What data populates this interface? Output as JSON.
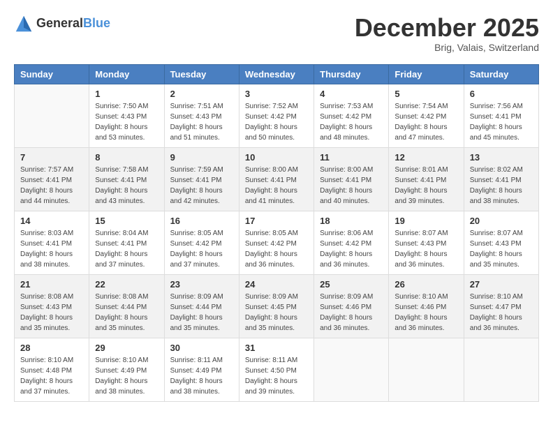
{
  "logo": {
    "text_general": "General",
    "text_blue": "Blue"
  },
  "title": "December 2025",
  "subtitle": "Brig, Valais, Switzerland",
  "days_of_week": [
    "Sunday",
    "Monday",
    "Tuesday",
    "Wednesday",
    "Thursday",
    "Friday",
    "Saturday"
  ],
  "weeks": [
    [
      {
        "day": "",
        "info": ""
      },
      {
        "day": "1",
        "info": "Sunrise: 7:50 AM\nSunset: 4:43 PM\nDaylight: 8 hours\nand 53 minutes."
      },
      {
        "day": "2",
        "info": "Sunrise: 7:51 AM\nSunset: 4:43 PM\nDaylight: 8 hours\nand 51 minutes."
      },
      {
        "day": "3",
        "info": "Sunrise: 7:52 AM\nSunset: 4:42 PM\nDaylight: 8 hours\nand 50 minutes."
      },
      {
        "day": "4",
        "info": "Sunrise: 7:53 AM\nSunset: 4:42 PM\nDaylight: 8 hours\nand 48 minutes."
      },
      {
        "day": "5",
        "info": "Sunrise: 7:54 AM\nSunset: 4:42 PM\nDaylight: 8 hours\nand 47 minutes."
      },
      {
        "day": "6",
        "info": "Sunrise: 7:56 AM\nSunset: 4:41 PM\nDaylight: 8 hours\nand 45 minutes."
      }
    ],
    [
      {
        "day": "7",
        "info": "Sunrise: 7:57 AM\nSunset: 4:41 PM\nDaylight: 8 hours\nand 44 minutes."
      },
      {
        "day": "8",
        "info": "Sunrise: 7:58 AM\nSunset: 4:41 PM\nDaylight: 8 hours\nand 43 minutes."
      },
      {
        "day": "9",
        "info": "Sunrise: 7:59 AM\nSunset: 4:41 PM\nDaylight: 8 hours\nand 42 minutes."
      },
      {
        "day": "10",
        "info": "Sunrise: 8:00 AM\nSunset: 4:41 PM\nDaylight: 8 hours\nand 41 minutes."
      },
      {
        "day": "11",
        "info": "Sunrise: 8:00 AM\nSunset: 4:41 PM\nDaylight: 8 hours\nand 40 minutes."
      },
      {
        "day": "12",
        "info": "Sunrise: 8:01 AM\nSunset: 4:41 PM\nDaylight: 8 hours\nand 39 minutes."
      },
      {
        "day": "13",
        "info": "Sunrise: 8:02 AM\nSunset: 4:41 PM\nDaylight: 8 hours\nand 38 minutes."
      }
    ],
    [
      {
        "day": "14",
        "info": "Sunrise: 8:03 AM\nSunset: 4:41 PM\nDaylight: 8 hours\nand 38 minutes."
      },
      {
        "day": "15",
        "info": "Sunrise: 8:04 AM\nSunset: 4:41 PM\nDaylight: 8 hours\nand 37 minutes."
      },
      {
        "day": "16",
        "info": "Sunrise: 8:05 AM\nSunset: 4:42 PM\nDaylight: 8 hours\nand 37 minutes."
      },
      {
        "day": "17",
        "info": "Sunrise: 8:05 AM\nSunset: 4:42 PM\nDaylight: 8 hours\nand 36 minutes."
      },
      {
        "day": "18",
        "info": "Sunrise: 8:06 AM\nSunset: 4:42 PM\nDaylight: 8 hours\nand 36 minutes."
      },
      {
        "day": "19",
        "info": "Sunrise: 8:07 AM\nSunset: 4:43 PM\nDaylight: 8 hours\nand 36 minutes."
      },
      {
        "day": "20",
        "info": "Sunrise: 8:07 AM\nSunset: 4:43 PM\nDaylight: 8 hours\nand 35 minutes."
      }
    ],
    [
      {
        "day": "21",
        "info": "Sunrise: 8:08 AM\nSunset: 4:43 PM\nDaylight: 8 hours\nand 35 minutes."
      },
      {
        "day": "22",
        "info": "Sunrise: 8:08 AM\nSunset: 4:44 PM\nDaylight: 8 hours\nand 35 minutes."
      },
      {
        "day": "23",
        "info": "Sunrise: 8:09 AM\nSunset: 4:44 PM\nDaylight: 8 hours\nand 35 minutes."
      },
      {
        "day": "24",
        "info": "Sunrise: 8:09 AM\nSunset: 4:45 PM\nDaylight: 8 hours\nand 35 minutes."
      },
      {
        "day": "25",
        "info": "Sunrise: 8:09 AM\nSunset: 4:46 PM\nDaylight: 8 hours\nand 36 minutes."
      },
      {
        "day": "26",
        "info": "Sunrise: 8:10 AM\nSunset: 4:46 PM\nDaylight: 8 hours\nand 36 minutes."
      },
      {
        "day": "27",
        "info": "Sunrise: 8:10 AM\nSunset: 4:47 PM\nDaylight: 8 hours\nand 36 minutes."
      }
    ],
    [
      {
        "day": "28",
        "info": "Sunrise: 8:10 AM\nSunset: 4:48 PM\nDaylight: 8 hours\nand 37 minutes."
      },
      {
        "day": "29",
        "info": "Sunrise: 8:10 AM\nSunset: 4:49 PM\nDaylight: 8 hours\nand 38 minutes."
      },
      {
        "day": "30",
        "info": "Sunrise: 8:11 AM\nSunset: 4:49 PM\nDaylight: 8 hours\nand 38 minutes."
      },
      {
        "day": "31",
        "info": "Sunrise: 8:11 AM\nSunset: 4:50 PM\nDaylight: 8 hours\nand 39 minutes."
      },
      {
        "day": "",
        "info": ""
      },
      {
        "day": "",
        "info": ""
      },
      {
        "day": "",
        "info": ""
      }
    ]
  ]
}
